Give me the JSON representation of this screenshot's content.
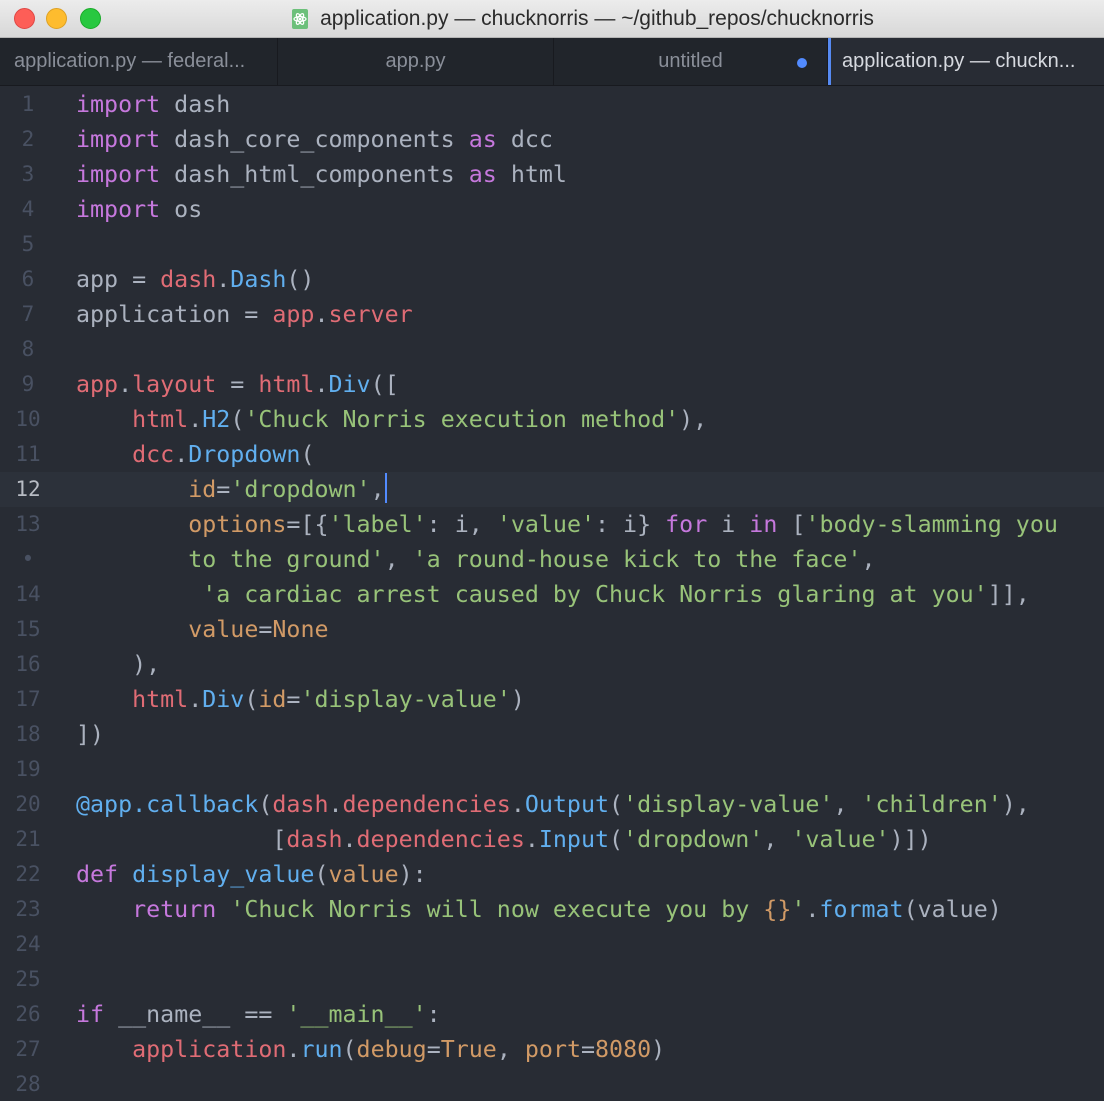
{
  "window": {
    "title": "application.py — chucknorris — ~/github_repos/chucknorris"
  },
  "tabs": [
    {
      "label": "application.py — federal..."
    },
    {
      "label": "app.py"
    },
    {
      "label": "untitled",
      "modified": true
    },
    {
      "label": "application.py — chuckn...",
      "active": true
    }
  ],
  "colors": {
    "editor_bg": "#282c34",
    "keyword": "#c678dd",
    "function": "#61afef",
    "identifier": "#e06c75",
    "string": "#98c379",
    "number": "#d19a66",
    "plain": "#abb2bf",
    "cursor": "#528bff"
  },
  "editor": {
    "active_line": 12,
    "lines": [
      {
        "num": "1",
        "tokens": [
          [
            "kw",
            "import"
          ],
          [
            "pl",
            " dash"
          ]
        ]
      },
      {
        "num": "2",
        "tokens": [
          [
            "kw",
            "import"
          ],
          [
            "pl",
            " dash_core_components "
          ],
          [
            "kw",
            "as"
          ],
          [
            "pl",
            " dcc"
          ]
        ]
      },
      {
        "num": "3",
        "tokens": [
          [
            "kw",
            "import"
          ],
          [
            "pl",
            " dash_html_components "
          ],
          [
            "kw",
            "as"
          ],
          [
            "pl",
            " html"
          ]
        ]
      },
      {
        "num": "4",
        "tokens": [
          [
            "kw",
            "import"
          ],
          [
            "pl",
            " os"
          ]
        ]
      },
      {
        "num": "5",
        "tokens": []
      },
      {
        "num": "6",
        "tokens": [
          [
            "pl",
            "app = "
          ],
          [
            "rd",
            "dash"
          ],
          [
            "pl",
            "."
          ],
          [
            "fn",
            "Dash"
          ],
          [
            "pl",
            "()"
          ]
        ]
      },
      {
        "num": "7",
        "tokens": [
          [
            "pl",
            "application = "
          ],
          [
            "rd",
            "app"
          ],
          [
            "pl",
            "."
          ],
          [
            "rd",
            "server"
          ]
        ]
      },
      {
        "num": "8",
        "tokens": []
      },
      {
        "num": "9",
        "tokens": [
          [
            "rd",
            "app"
          ],
          [
            "pl",
            "."
          ],
          [
            "rd",
            "layout"
          ],
          [
            "pl",
            " = "
          ],
          [
            "rd",
            "html"
          ],
          [
            "pl",
            "."
          ],
          [
            "fn",
            "Div"
          ],
          [
            "pl",
            "(["
          ]
        ]
      },
      {
        "num": "10",
        "tokens": [
          [
            "pl",
            "    "
          ],
          [
            "rd",
            "html"
          ],
          [
            "pl",
            "."
          ],
          [
            "fn",
            "H2"
          ],
          [
            "pl",
            "("
          ],
          [
            "st",
            "'Chuck Norris execution method'"
          ],
          [
            "pl",
            "),"
          ]
        ]
      },
      {
        "num": "11",
        "tokens": [
          [
            "pl",
            "    "
          ],
          [
            "rd",
            "dcc"
          ],
          [
            "pl",
            "."
          ],
          [
            "fn",
            "Dropdown"
          ],
          [
            "pl",
            "("
          ]
        ]
      },
      {
        "num": "12",
        "tokens": [
          [
            "pl",
            "        "
          ],
          [
            "or",
            "id"
          ],
          [
            "pl",
            "="
          ],
          [
            "st",
            "'dropdown'"
          ],
          [
            "pl",
            ","
          ]
        ],
        "cursor": true
      },
      {
        "num": "13",
        "tokens": [
          [
            "pl",
            "        "
          ],
          [
            "or",
            "options"
          ],
          [
            "pl",
            "=[{"
          ],
          [
            "st",
            "'label'"
          ],
          [
            "pl",
            ": i, "
          ],
          [
            "st",
            "'value'"
          ],
          [
            "pl",
            ": i} "
          ],
          [
            "kw",
            "for"
          ],
          [
            "pl",
            " i "
          ],
          [
            "kw",
            "in"
          ],
          [
            "pl",
            " ["
          ],
          [
            "st",
            "'body-slamming you"
          ]
        ]
      },
      {
        "num": "•",
        "tokens": [
          [
            "pl",
            "        "
          ],
          [
            "st",
            "to the ground'"
          ],
          [
            "pl",
            ", "
          ],
          [
            "st",
            "'a round-house kick to the face'"
          ],
          [
            "pl",
            ","
          ]
        ]
      },
      {
        "num": "14",
        "tokens": [
          [
            "pl",
            "         "
          ],
          [
            "st",
            "'a cardiac arrest caused by Chuck Norris glaring at you'"
          ],
          [
            "pl",
            "]],"
          ]
        ]
      },
      {
        "num": "15",
        "tokens": [
          [
            "pl",
            "        "
          ],
          [
            "or",
            "value"
          ],
          [
            "pl",
            "="
          ],
          [
            "or",
            "None"
          ]
        ]
      },
      {
        "num": "16",
        "tokens": [
          [
            "pl",
            "    ),"
          ]
        ]
      },
      {
        "num": "17",
        "tokens": [
          [
            "pl",
            "    "
          ],
          [
            "rd",
            "html"
          ],
          [
            "pl",
            "."
          ],
          [
            "fn",
            "Div"
          ],
          [
            "pl",
            "("
          ],
          [
            "or",
            "id"
          ],
          [
            "pl",
            "="
          ],
          [
            "st",
            "'display-value'"
          ],
          [
            "pl",
            ")"
          ]
        ]
      },
      {
        "num": "18",
        "tokens": [
          [
            "pl",
            "])"
          ]
        ]
      },
      {
        "num": "19",
        "tokens": []
      },
      {
        "num": "20",
        "tokens": [
          [
            "fn",
            "@app.callback"
          ],
          [
            "pl",
            "("
          ],
          [
            "rd",
            "dash"
          ],
          [
            "pl",
            "."
          ],
          [
            "rd",
            "dependencies"
          ],
          [
            "pl",
            "."
          ],
          [
            "fn",
            "Output"
          ],
          [
            "pl",
            "("
          ],
          [
            "st",
            "'display-value'"
          ],
          [
            "pl",
            ", "
          ],
          [
            "st",
            "'children'"
          ],
          [
            "pl",
            "),"
          ]
        ]
      },
      {
        "num": "21",
        "tokens": [
          [
            "pl",
            "              ["
          ],
          [
            "rd",
            "dash"
          ],
          [
            "pl",
            "."
          ],
          [
            "rd",
            "dependencies"
          ],
          [
            "pl",
            "."
          ],
          [
            "fn",
            "Input"
          ],
          [
            "pl",
            "("
          ],
          [
            "st",
            "'dropdown'"
          ],
          [
            "pl",
            ", "
          ],
          [
            "st",
            "'value'"
          ],
          [
            "pl",
            ")])"
          ]
        ]
      },
      {
        "num": "22",
        "tokens": [
          [
            "kw",
            "def"
          ],
          [
            "pl",
            " "
          ],
          [
            "fn",
            "display_value"
          ],
          [
            "pl",
            "("
          ],
          [
            "or",
            "value"
          ],
          [
            "pl",
            "):"
          ]
        ]
      },
      {
        "num": "23",
        "tokens": [
          [
            "pl",
            "    "
          ],
          [
            "kw",
            "return"
          ],
          [
            "pl",
            " "
          ],
          [
            "st",
            "'Chuck Norris will now execute you by "
          ],
          [
            "or",
            "{}"
          ],
          [
            "st",
            "'"
          ],
          [
            "pl",
            "."
          ],
          [
            "fn",
            "format"
          ],
          [
            "pl",
            "(value)"
          ]
        ]
      },
      {
        "num": "24",
        "tokens": []
      },
      {
        "num": "25",
        "tokens": []
      },
      {
        "num": "26",
        "tokens": [
          [
            "kw",
            "if"
          ],
          [
            "pl",
            " __name__ == "
          ],
          [
            "st",
            "'__main__'"
          ],
          [
            "pl",
            ":"
          ]
        ]
      },
      {
        "num": "27",
        "tokens": [
          [
            "pl",
            "    "
          ],
          [
            "rd",
            "application"
          ],
          [
            "pl",
            "."
          ],
          [
            "fn",
            "run"
          ],
          [
            "pl",
            "("
          ],
          [
            "or",
            "debug"
          ],
          [
            "pl",
            "="
          ],
          [
            "or",
            "True"
          ],
          [
            "pl",
            ", "
          ],
          [
            "or",
            "port"
          ],
          [
            "pl",
            "="
          ],
          [
            "or",
            "8080"
          ],
          [
            "pl",
            ")"
          ]
        ]
      },
      {
        "num": "28",
        "tokens": []
      }
    ]
  }
}
